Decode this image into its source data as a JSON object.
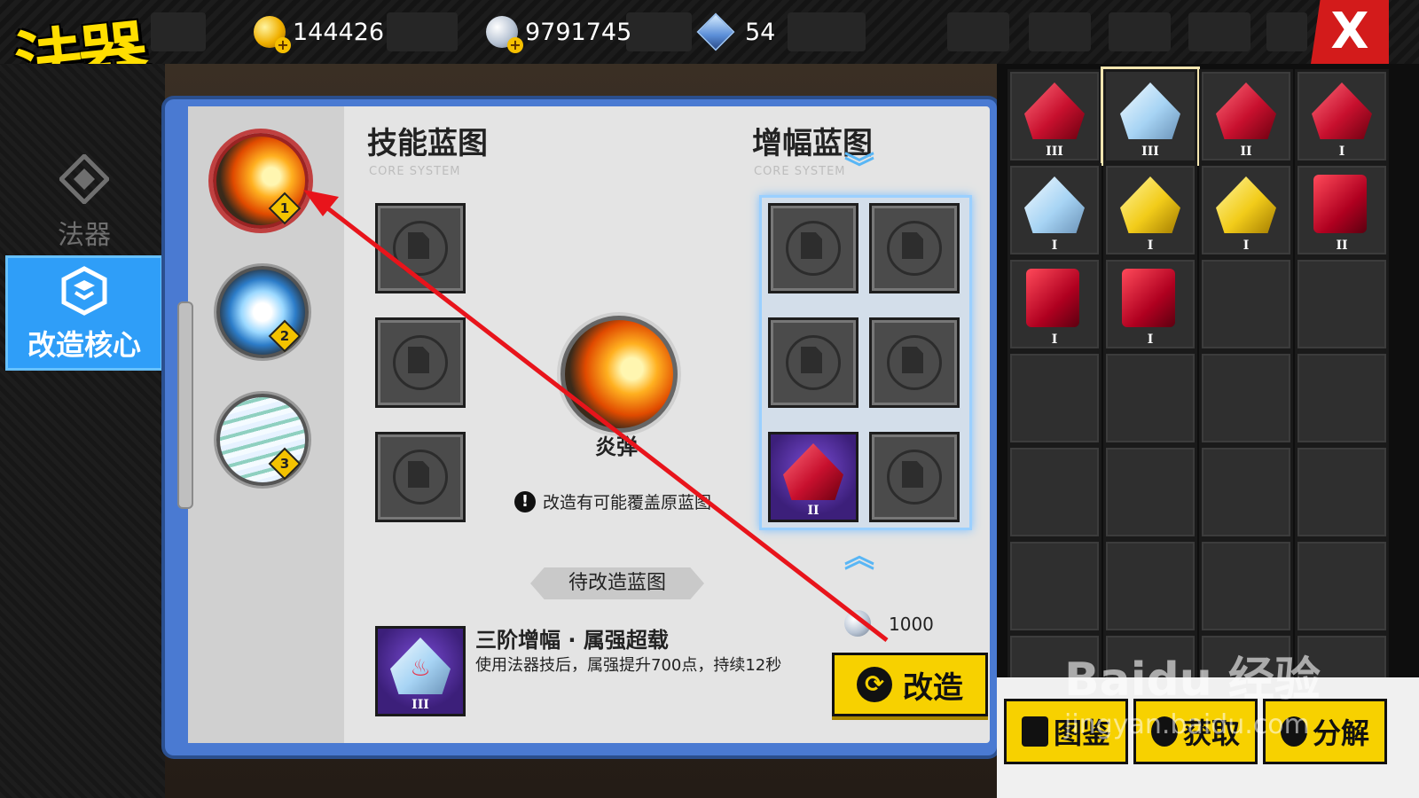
{
  "header": {
    "title": "法器",
    "gold": "144426",
    "silver": "9791745",
    "gems": "54",
    "close_label": "X"
  },
  "nav": {
    "items": [
      {
        "label": "法器",
        "icon": "artifact-icon"
      },
      {
        "label": "改造核心",
        "icon": "core-icon"
      }
    ]
  },
  "skills": [
    {
      "rank": "1",
      "icon": "fireball-icon"
    },
    {
      "rank": "2",
      "icon": "ice-ring-icon"
    },
    {
      "rank": "3",
      "icon": "tornado-icon"
    }
  ],
  "skill_blueprint": {
    "title": "技能蓝图",
    "subtitle": "CORE SYSTEM"
  },
  "amp_blueprint": {
    "title": "增幅蓝图",
    "subtitle": "CORE SYSTEM"
  },
  "core": {
    "name": "炎弹",
    "warning": "改造有可能覆盖原蓝图"
  },
  "pending": {
    "section_label": "待改造蓝图",
    "name": "三阶增幅 · 属强超载",
    "description": "使用法器技后，属强提升700点，持续12秒",
    "tier": "III"
  },
  "reforge": {
    "cost": "1000",
    "label": "改造"
  },
  "inventory": {
    "items": [
      {
        "tier": "III",
        "kind": "red-gem"
      },
      {
        "tier": "III",
        "kind": "ice-gem"
      },
      {
        "tier": "II",
        "kind": "red-gem"
      },
      {
        "tier": "I",
        "kind": "red-gem"
      },
      {
        "tier": "I",
        "kind": "ice-gem"
      },
      {
        "tier": "I",
        "kind": "gold-gem"
      },
      {
        "tier": "I",
        "kind": "gold-gem"
      },
      {
        "tier": "II",
        "kind": "red-book"
      },
      {
        "tier": "I",
        "kind": "red-book"
      },
      {
        "tier": "I",
        "kind": "red-book"
      }
    ]
  },
  "footer": {
    "catalog_label": "图鉴",
    "obtain_label": "获取",
    "decompose_label": "分解"
  },
  "watermark": {
    "brand": "Baidu 经验",
    "url": "jingyan.baidu.com"
  },
  "colors": {
    "accent_yellow": "#f7d100",
    "nav_active": "#2f9ef8",
    "annotation_red": "#e8141b",
    "close_red": "#d31b1b"
  }
}
